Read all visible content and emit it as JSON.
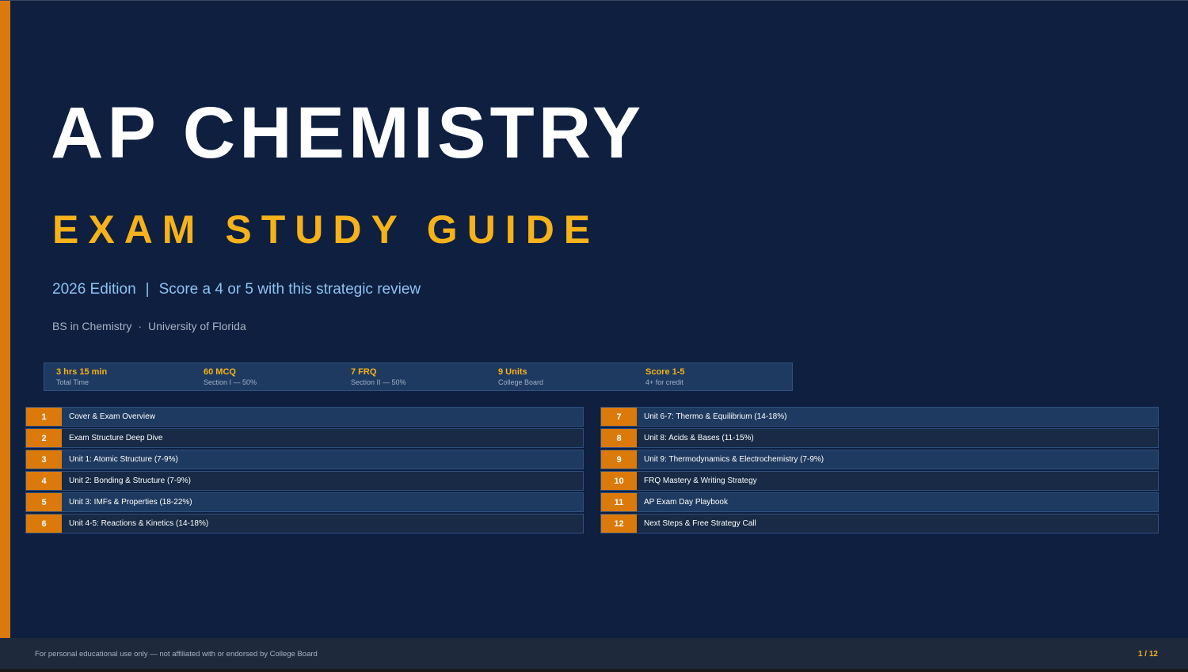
{
  "title": "AP CHEMISTRY",
  "subtitle": "EXAM STUDY GUIDE",
  "tagline": {
    "edition": "2026 Edition",
    "separator": "|",
    "text": "Score a 4 or 5 with this strategic review"
  },
  "credentials": {
    "degree": "BS in Chemistry",
    "dot": "·",
    "school": "University of Florida"
  },
  "stats": [
    {
      "value": "3 hrs 15 min",
      "label": "Total Time"
    },
    {
      "value": "60 MCQ",
      "label": "Section I — 50%"
    },
    {
      "value": "7 FRQ",
      "label": "Section II — 50%"
    },
    {
      "value": "9 Units",
      "label": "College Board"
    },
    {
      "value": "Score 1-5",
      "label": "4+ for credit"
    }
  ],
  "contents": [
    {
      "num": "1",
      "label": "Cover & Exam Overview"
    },
    {
      "num": "2",
      "label": "Exam Structure Deep Dive"
    },
    {
      "num": "3",
      "label": "Unit 1: Atomic Structure (7-9%)"
    },
    {
      "num": "4",
      "label": "Unit 2: Bonding & Structure (7-9%)"
    },
    {
      "num": "5",
      "label": "Unit 3: IMFs & Properties (18-22%)"
    },
    {
      "num": "6",
      "label": "Unit 4-5: Reactions & Kinetics (14-18%)"
    },
    {
      "num": "7",
      "label": "Unit 6-7: Thermo & Equilibrium (14-18%)"
    },
    {
      "num": "8",
      "label": "Unit 8: Acids & Bases (11-15%)"
    },
    {
      "num": "9",
      "label": "Unit 9: Thermodynamics & Electrochemistry (7-9%)"
    },
    {
      "num": "10",
      "label": "FRQ Mastery & Writing Strategy"
    },
    {
      "num": "11",
      "label": "AP Exam Day Playbook"
    },
    {
      "num": "12",
      "label": "Next Steps & Free Strategy Call"
    }
  ],
  "footer": {
    "note": "For personal educational use only — not affiliated with or endorsed by College Board",
    "page": "1 / 12"
  },
  "colors": {
    "background": "#0f1f40",
    "accent": "#db7a0b",
    "gold": "#f5b21b",
    "light_blue": "#8cc3f0"
  }
}
